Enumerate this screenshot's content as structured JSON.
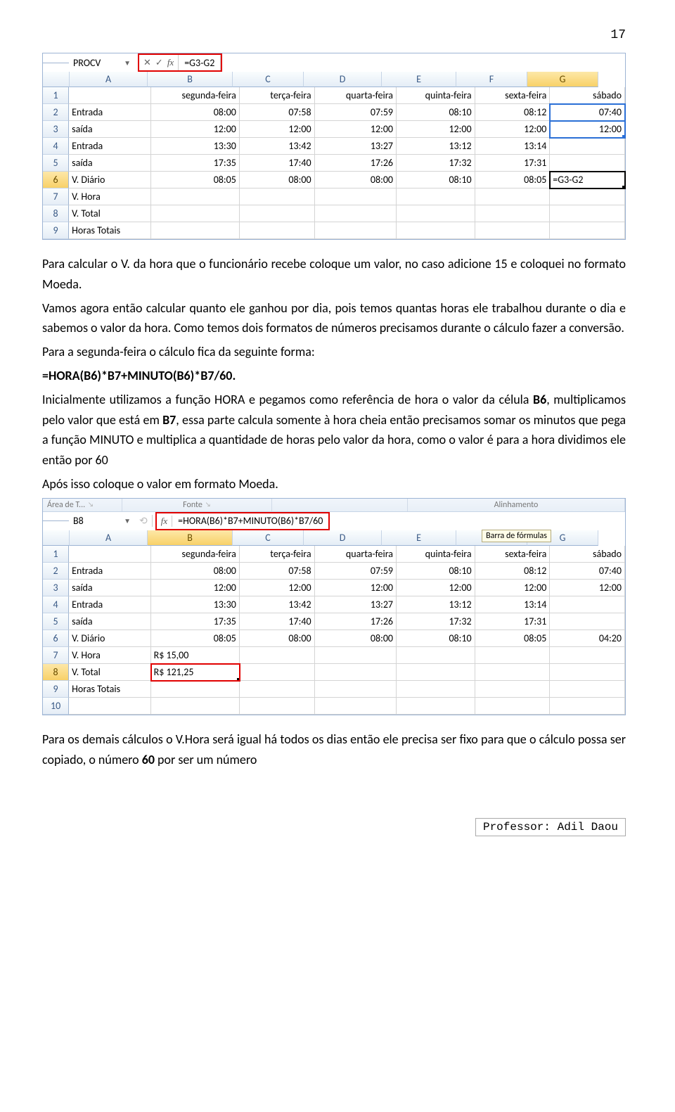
{
  "pagenum": "17",
  "excel1": {
    "namebox": "PROCV",
    "formula": "=G3-G2",
    "cols": [
      "A",
      "B",
      "C",
      "D",
      "E",
      "F",
      "G"
    ],
    "widths": [
      "wA",
      "wB",
      "wC",
      "wD",
      "wE",
      "wF",
      "wG"
    ],
    "rows": [
      {
        "n": "1",
        "c": [
          "",
          "segunda-feira",
          "terça-feira",
          "quarta-feira",
          "quinta-feira",
          "sexta-feira",
          "sábado"
        ]
      },
      {
        "n": "2",
        "c": [
          "Entrada",
          "08:00",
          "07:58",
          "07:59",
          "08:10",
          "08:12",
          "07:40"
        ]
      },
      {
        "n": "3",
        "c": [
          "saída",
          "12:00",
          "12:00",
          "12:00",
          "12:00",
          "12:00",
          "12:00"
        ]
      },
      {
        "n": "4",
        "c": [
          "Entrada",
          "13:30",
          "13:42",
          "13:27",
          "13:12",
          "13:14",
          ""
        ]
      },
      {
        "n": "5",
        "c": [
          "saída",
          "17:35",
          "17:40",
          "17:26",
          "17:32",
          "17:31",
          ""
        ]
      },
      {
        "n": "6",
        "c": [
          "V. Diário",
          "08:05",
          "08:00",
          "08:00",
          "08:10",
          "08:05",
          "=G3-G2"
        ]
      },
      {
        "n": "7",
        "c": [
          "V. Hora",
          "",
          "",
          "",
          "",
          "",
          ""
        ]
      },
      {
        "n": "8",
        "c": [
          "V. Total",
          "",
          "",
          "",
          "",
          "",
          ""
        ]
      },
      {
        "n": "9",
        "c": [
          "Horas Totais",
          "",
          "",
          "",
          "",
          "",
          ""
        ]
      }
    ]
  },
  "para1": [
    "Para calcular o V. da hora que o funcionário recebe coloque um valor, no caso adicione 15 e coloquei no formato Moeda.",
    "Vamos agora então calcular quanto ele ganhou por dia, pois temos quantas horas ele trabalhou durante o dia e sabemos o valor da hora. Como temos dois formatos de números precisamos durante o cálculo fazer a conversão.",
    "Para a segunda-feira o cálculo fica da seguinte forma:"
  ],
  "formula_bold": "=HORA(B6)*B7+MINUTO(B6)*B7/60",
  "para2a": "Inicialmente utilizamos a função HORA e pegamos como referência de hora o valor da célula ",
  "b6": "B6",
  "para2b": ", multiplicamos pelo valor que está em ",
  "b7": "B7",
  "para2c": ", essa parte calcula somente à hora cheia então precisamos somar os minutos que pega a função MINUTO e multiplica a quantidade de horas pelo valor da hora, como o valor é para a hora dividimos ele então por 60",
  "para3": "Após isso coloque o valor em formato Moeda.",
  "excel2": {
    "ribbon": [
      "Área de T...",
      "Fonte",
      "",
      "Alinhamento"
    ],
    "namebox": "B8",
    "formula": "=HORA(B6)*B7+MINUTO(B6)*B7/60",
    "tooltip": "Barra de fórmulas",
    "cols": [
      "A",
      "B",
      "C",
      "D",
      "E",
      "F",
      "G"
    ],
    "rows": [
      {
        "n": "1",
        "c": [
          "",
          "segunda-feira",
          "terça-feira",
          "quarta-feira",
          "quinta-feira",
          "sexta-feira",
          "sábado"
        ]
      },
      {
        "n": "2",
        "c": [
          "Entrada",
          "08:00",
          "07:58",
          "07:59",
          "08:10",
          "08:12",
          "07:40"
        ]
      },
      {
        "n": "3",
        "c": [
          "saída",
          "12:00",
          "12:00",
          "12:00",
          "12:00",
          "12:00",
          "12:00"
        ]
      },
      {
        "n": "4",
        "c": [
          "Entrada",
          "13:30",
          "13:42",
          "13:27",
          "13:12",
          "13:14",
          ""
        ]
      },
      {
        "n": "5",
        "c": [
          "saída",
          "17:35",
          "17:40",
          "17:26",
          "17:32",
          "17:31",
          ""
        ]
      },
      {
        "n": "6",
        "c": [
          "V. Diário",
          "08:05",
          "08:00",
          "08:00",
          "08:10",
          "08:05",
          "04:20"
        ]
      },
      {
        "n": "7",
        "c": [
          "V. Hora",
          "R$       15,00",
          "",
          "",
          "",
          "",
          ""
        ]
      },
      {
        "n": "8",
        "c": [
          "V. Total",
          "R$     121,25",
          "",
          "",
          "",
          "",
          ""
        ]
      },
      {
        "n": "9",
        "c": [
          "Horas Totais",
          "",
          "",
          "",
          "",
          "",
          ""
        ]
      },
      {
        "n": "10",
        "c": [
          "",
          "",
          "",
          "",
          "",
          "",
          ""
        ]
      }
    ]
  },
  "para4a": "Para os demais cálculos o V.Hora será igual há todos os dias então ele precisa ser fixo para que o cálculo possa ser copiado, o número ",
  "sixty": "60",
  "para4b": " por ser um número",
  "footer": "Professor: Adil Daou"
}
